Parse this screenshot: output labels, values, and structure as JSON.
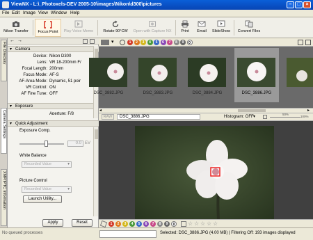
{
  "window": {
    "title": "ViewNX - L:\\_Photoxels-DEV 2005-10\\images\\Nikon\\d300\\pictures"
  },
  "menu": [
    "File",
    "Edit",
    "Image",
    "View",
    "Window",
    "Help"
  ],
  "toolbar": {
    "nikon_transfer": "Nikon Transfer",
    "focus_point": "Focus Point",
    "play_voice_memo": "Play Voice Memo",
    "rotate": "Rotate 90°CW",
    "open_capture_nx": "Open with Capture NX",
    "print": "Print",
    "email": "Email",
    "slideshow": "SlideShow",
    "convert_files": "Convert Files"
  },
  "left_tabs": [
    "File Directory",
    "Camera Settings",
    "XMP/IPTC Information"
  ],
  "camera": {
    "section_title": "Camera",
    "rows": [
      {
        "k": "Device:",
        "v": "Nikon D300"
      },
      {
        "k": "Lens:",
        "v": "VR 18-200mm F/"
      },
      {
        "k": "Focal Length:",
        "v": "200mm"
      },
      {
        "k": "Focus Mode:",
        "v": "AF-S"
      },
      {
        "k": "AF-Area Mode:",
        "v": "Dynamic, 51 poir"
      },
      {
        "k": "VR Control:",
        "v": "ON"
      },
      {
        "k": "AF Fine Tune:",
        "v": "OFF"
      }
    ]
  },
  "exposure": {
    "section_title": "Exposure",
    "partial_row": "Aperture: F/8"
  },
  "quick_adjustment": {
    "section_title": "Quick Adjustment",
    "exposure_comp_label": "Exposure Comp.",
    "exposure_comp_value": "0.0",
    "exposure_comp_unit": "EV",
    "white_balance_label": "White Balance",
    "white_balance_value": "Recorded Value",
    "picture_control_label": "Picture Control",
    "picture_control_value": "Recorded Value",
    "launch_utility": "Launch Utility..."
  },
  "panel_buttons": {
    "apply": "Apply",
    "reset": "Reset"
  },
  "label_dots": [
    {
      "n": "1",
      "color": "#d23a2a"
    },
    {
      "n": "2",
      "color": "#e07a20"
    },
    {
      "n": "3",
      "color": "#d4b81c"
    },
    {
      "n": "4",
      "color": "#4a9a3a"
    },
    {
      "n": "5",
      "color": "#3a6ac8"
    },
    {
      "n": "6",
      "color": "#8a4ab8"
    },
    {
      "n": "7",
      "color": "#c84a8a"
    },
    {
      "n": "8",
      "color": "#8a8a8a"
    },
    {
      "n": "9",
      "color": "#6a6a6a"
    },
    {
      "n": "0",
      "color": "#ffffff"
    }
  ],
  "thumbnails": [
    {
      "name": "DSC_3882.JPG",
      "selected": false
    },
    {
      "name": "DSC_3883.JPG",
      "selected": false
    },
    {
      "name": "DSC_3884.JPG",
      "selected": false
    },
    {
      "name": "DSC_3886.JPG",
      "selected": true
    },
    {
      "name": "",
      "selected": false
    }
  ],
  "viewer_bar": {
    "raw": "RAW",
    "filename": "DSC_3886.JPG",
    "histogram": "Histogram: OFF",
    "zoom": "50%",
    "zoom_max": "100%"
  },
  "status": {
    "queue": "No queued processes",
    "selection": "Selected: DSC_3886.JPG (4.00 MB) | Filtering Off: 193 images displayed"
  }
}
